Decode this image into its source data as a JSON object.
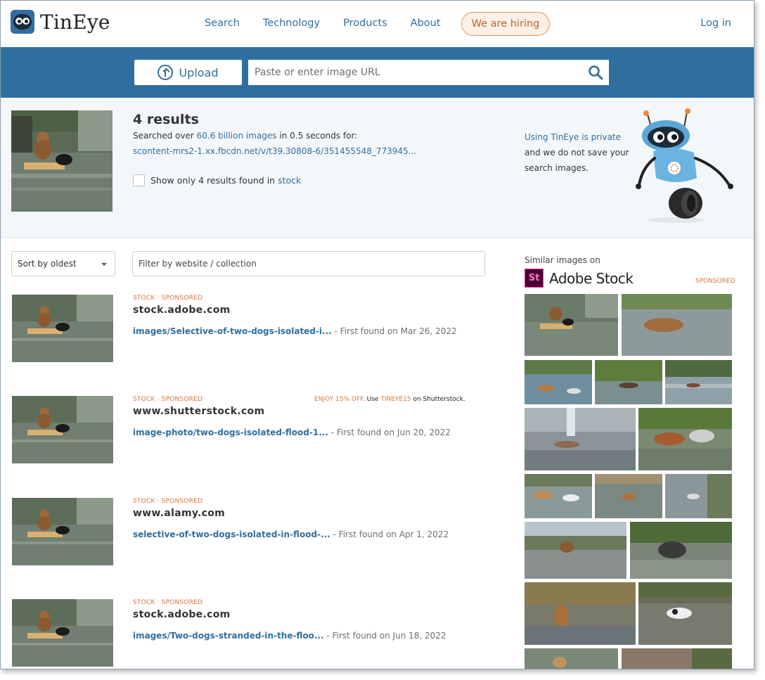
{
  "header": {
    "logo_text": "TinEye",
    "nav": [
      "Search",
      "Technology",
      "Products",
      "About"
    ],
    "hiring": "We are hiring",
    "login": "Log in"
  },
  "searchbar": {
    "upload_label": "Upload",
    "url_placeholder": "Paste or enter image URL"
  },
  "summary": {
    "results_count": "4 results",
    "searched_prefix": "Searched over",
    "searched_link": "60.6 billion images",
    "searched_suffix": "in 0.5 seconds for:",
    "query_url": "scontent-mrs2-1.xx.fbcdn.net/v/t39.30808-6/351455548_773945...",
    "stock_filter_prefix": "Show only 4 results found in",
    "stock_filter_link": "stock",
    "privacy_link": "Using TinEye is private",
    "privacy_text": "and we do not save your search images."
  },
  "filters": {
    "sort_label": "Sort by oldest",
    "filter_placeholder": "Filter by website / collection"
  },
  "results": [
    {
      "tag": "STOCK · SPONSORED",
      "domain": "stock.adobe.com",
      "path": "images/Selective-of-two-dogs-isolated-i...",
      "found": "- First found on Mar 26, 2022"
    },
    {
      "tag": "STOCK · SPONSORED",
      "domain": "www.shutterstock.com",
      "path": "image-photo/two-dogs-isolated-flood-1...",
      "found": "- First found on Jun 20, 2022",
      "promo_offer": "ENJOY 15% OFF.",
      "promo_use": "Use",
      "promo_code": "TINEYE15",
      "promo_suffix": "on Shutterstock."
    },
    {
      "tag": "STOCK · SPONSORED",
      "domain": "www.alamy.com",
      "path": "selective-of-two-dogs-isolated-in-flood-...",
      "found": "- First found on Apr 1, 2022"
    },
    {
      "tag": "STOCK · SPONSORED",
      "domain": "stock.adobe.com",
      "path": "images/Two-dogs-stranded-in-the-floo...",
      "found": "- First found on Jun 18, 2022"
    }
  ],
  "sidebar": {
    "similar_label": "Similar images on",
    "adobe_badge": "St",
    "adobe_name": "Adobe Stock",
    "sponsored": "SPONSORED"
  },
  "colors": {
    "brand_blue": "#2f6fa0",
    "accent_orange": "#d9753a",
    "summary_bg": "#f4f7fa"
  }
}
